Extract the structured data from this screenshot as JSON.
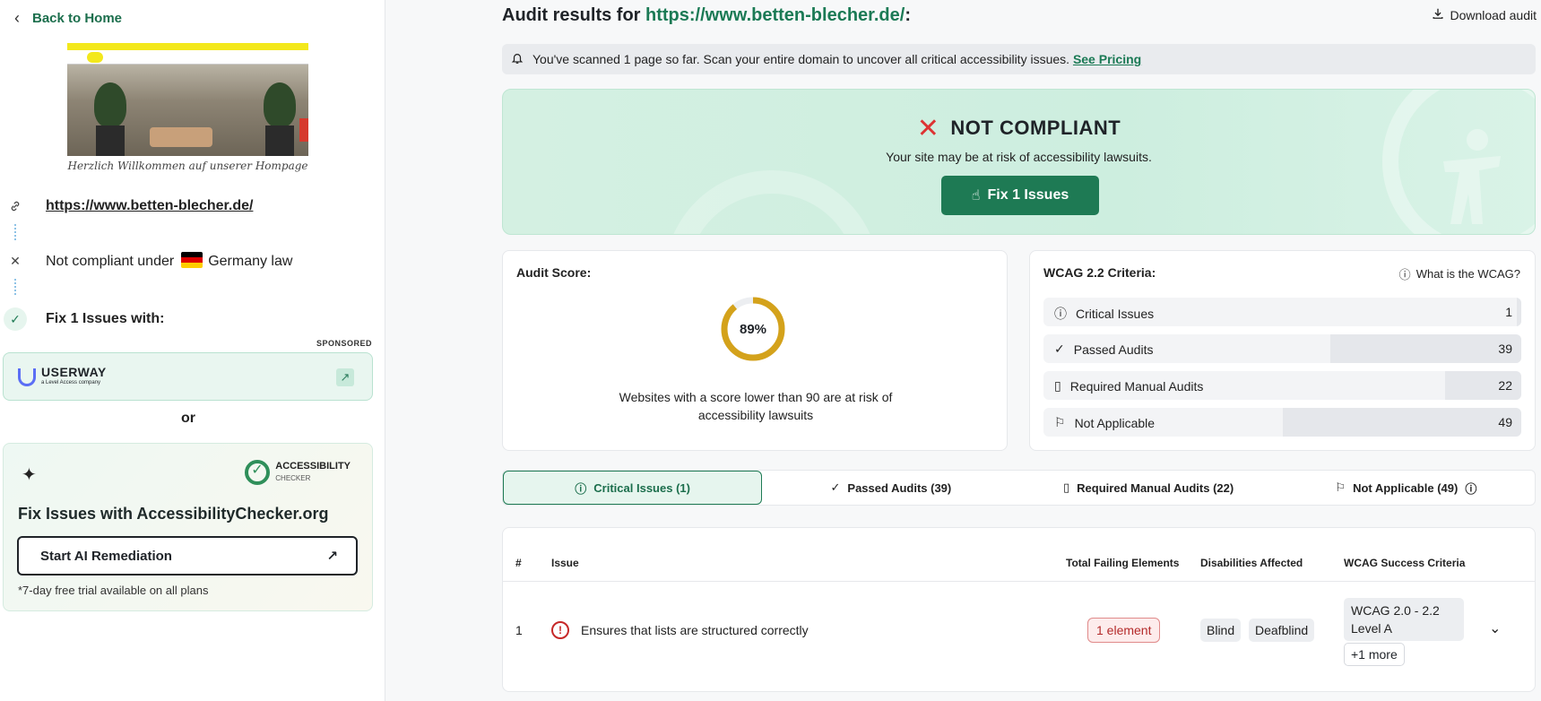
{
  "sidebar": {
    "back_label": "Back to Home",
    "tagline": "Herzlich Willkommen auf unserer Hompage",
    "url": "https://www.betten-blecher.de/",
    "compliance_text": "Not compliant under",
    "law": "Germany law",
    "fix_text": "Fix 1 Issues with:",
    "sponsored": "SPONSORED",
    "userway": {
      "name": "USERWAY",
      "sub": "a Level Access company"
    },
    "or": "or",
    "ac": {
      "logo_line1": "ACCESSIBILITY",
      "logo_line2": "CHECKER",
      "title": "Fix Issues with AccessibilityChecker.org",
      "button": "Start AI Remediation",
      "note": "*7-day free trial available on all plans"
    }
  },
  "header": {
    "title_prefix": "Audit results for",
    "title_url": "https://www.betten-blecher.de/",
    "title_suffix": ":",
    "download": "Download audit"
  },
  "banner": {
    "text": "You've scanned 1 page so far. Scan your entire domain to uncover all critical accessibility issues.",
    "link": "See Pricing"
  },
  "hero": {
    "status": "NOT COMPLIANT",
    "subtitle": "Your site may be at risk of accessibility lawsuits.",
    "button": "Fix 1 Issues"
  },
  "score": {
    "heading": "Audit Score:",
    "value": 89,
    "value_label": "89%",
    "note": "Websites with a score lower than 90 are at risk of accessibility lawsuits",
    "color": "#d4a21b"
  },
  "wcag": {
    "heading": "WCAG 2.2 Criteria:",
    "link": "What is the WCAG?",
    "rows": [
      {
        "label": "Critical Issues",
        "value": "1",
        "fraction": 0.01
      },
      {
        "label": "Passed Audits",
        "value": "39",
        "fraction": 0.4
      },
      {
        "label": "Required Manual Audits",
        "value": "22",
        "fraction": 0.16
      },
      {
        "label": "Not Applicable",
        "value": "49",
        "fraction": 0.5
      }
    ]
  },
  "tabs": [
    {
      "label": "Critical Issues (1)",
      "icon": "alert-circle-icon"
    },
    {
      "label": "Passed Audits (39)",
      "icon": "check-icon"
    },
    {
      "label": "Required Manual Audits (22)",
      "icon": "file-icon"
    },
    {
      "label": "Not Applicable (49)",
      "icon": "flag-icon"
    }
  ],
  "table": {
    "headers": [
      "#",
      "Issue",
      "Total Failing Elements",
      "Disabilities Affected",
      "WCAG Success Criteria"
    ],
    "rows": [
      {
        "num": "1",
        "issue": "Ensures that lists are structured correctly",
        "failing": "1 element",
        "disabilities": [
          "Blind",
          "Deafblind"
        ],
        "wcag": "WCAG 2.0 - 2.2 Level A",
        "more": "+1 more"
      }
    ]
  },
  "colors": {
    "brand": "#1e7a54",
    "danger": "#d33333"
  }
}
